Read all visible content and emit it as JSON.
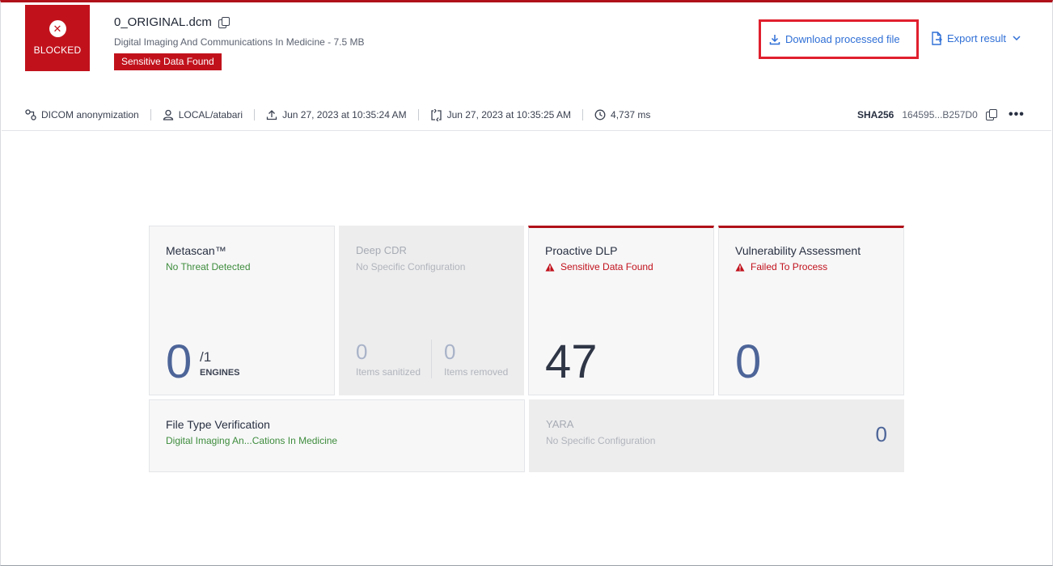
{
  "verdict": {
    "label": "BLOCKED"
  },
  "file": {
    "name": "0_ORIGINAL.dcm",
    "subtitle": "Digital Imaging And Communications In Medicine - 7.5 MB",
    "badge": "Sensitive Data Found"
  },
  "actions": {
    "download_label": "Download processed file",
    "export_label": "Export result"
  },
  "meta": {
    "workflow": "DICOM anonymization",
    "user": "LOCAL/atabari",
    "uploaded": "Jun 27, 2023 at 10:35:24 AM",
    "processed": "Jun 27, 2023 at 10:35:25 AM",
    "duration": "4,737 ms",
    "hash_label": "SHA256",
    "hash_value": "164595...B257D0",
    "more_label": "•••"
  },
  "cards": {
    "metascan": {
      "title": "Metascan™",
      "status": "No Threat Detected",
      "value": "0",
      "total": "/1",
      "unit": "ENGINES"
    },
    "deep_cdr": {
      "title": "Deep CDR",
      "status": "No Specific Configuration",
      "sanitized_value": "0",
      "sanitized_label": "Items sanitized",
      "removed_value": "0",
      "removed_label": "Items removed"
    },
    "proactive_dlp": {
      "title": "Proactive DLP",
      "status": "Sensitive Data Found",
      "value": "47"
    },
    "vuln": {
      "title": "Vulnerability Assessment",
      "status": "Failed To Process",
      "value": "0"
    },
    "ftv": {
      "title": "File Type Verification",
      "status": "Digital Imaging An...Cations In Medicine"
    },
    "yara": {
      "title": "YARA",
      "status": "No Specific Configuration",
      "value": "0"
    }
  },
  "colors": {
    "brand_red": "#c1121c",
    "link_blue": "#2f6fd6",
    "ok_green": "#3e8c3c",
    "value_blue": "#4d6598"
  }
}
